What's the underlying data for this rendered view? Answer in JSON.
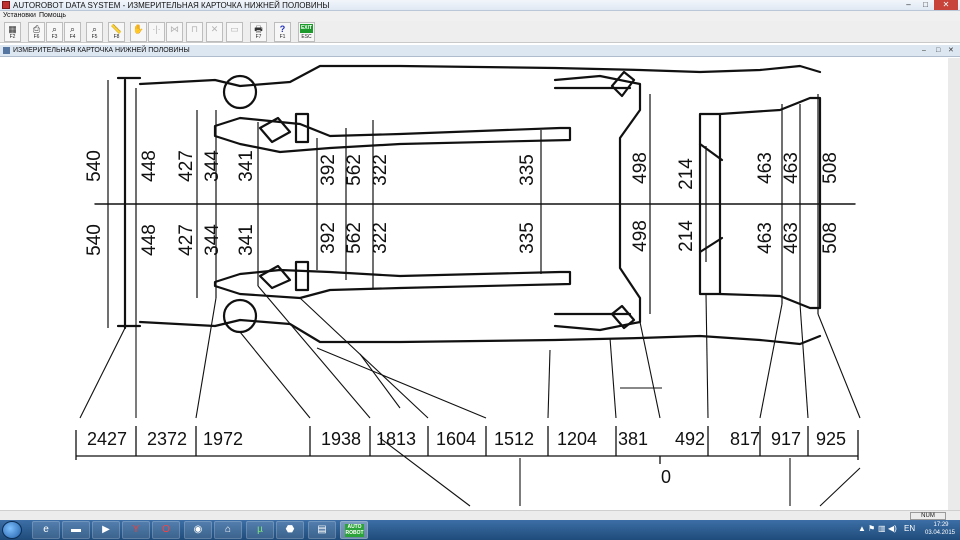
{
  "window": {
    "title": "AUTOROBOT DATA SYSTEM - ИЗМЕРИТЕЛЬНАЯ КАРТОЧКА НИЖНЕЙ ПОЛОВИНЫ",
    "minimize_glyph": "–",
    "maximize_glyph": "□",
    "close_glyph": "✕"
  },
  "menu": {
    "items": [
      {
        "label": "Установки"
      },
      {
        "label": "Помощь"
      }
    ]
  },
  "toolbar": {
    "buttons": [
      {
        "icon": "calculator-icon",
        "glyph": "▦",
        "key": "F2",
        "enabled": true
      },
      {
        "icon": "print-preview-icon",
        "glyph": "⎙",
        "key": "F6",
        "enabled": true
      },
      {
        "icon": "zoom-page-icon",
        "glyph": "⌕",
        "key": "F3",
        "enabled": true
      },
      {
        "icon": "zoom-in-icon",
        "glyph": "⌕",
        "key": "F4",
        "enabled": true
      },
      {
        "icon": "zoom-pointer-icon",
        "glyph": "⌕",
        "key": "F5",
        "enabled": true
      },
      {
        "icon": "ruler-icon",
        "glyph": "📏",
        "key": "F8",
        "enabled": true
      },
      {
        "icon": "hand-icon",
        "glyph": "✋",
        "key": "",
        "enabled": false
      },
      {
        "icon": "measure-point-icon",
        "glyph": "·|·",
        "key": "",
        "enabled": false
      },
      {
        "icon": "mirror-icon",
        "glyph": "⋈",
        "key": "",
        "enabled": false
      },
      {
        "icon": "bracket-icon",
        "glyph": "⊓",
        "key": "",
        "enabled": false
      },
      {
        "icon": "cross-icon",
        "glyph": "✕",
        "key": "",
        "enabled": false
      },
      {
        "icon": "panel-icon",
        "glyph": "▭",
        "key": "",
        "enabled": false
      },
      {
        "icon": "printer-icon",
        "glyph": "🖶",
        "key": "F7",
        "enabled": true
      },
      {
        "icon": "help-icon",
        "glyph": "?",
        "key": "F1",
        "enabled": true
      },
      {
        "icon": "exit-icon",
        "glyph": "EXIT",
        "key": "ESC",
        "enabled": true
      }
    ]
  },
  "inner_window": {
    "title": "ИЗМЕРИТЕЛЬНАЯ КАРТОЧКА НИЖНЕЙ ПОЛОВИНЫ",
    "minimize_glyph": "–",
    "maximize_glyph": "□",
    "close_glyph": "✕"
  },
  "drawing": {
    "stroke_color": "#111111",
    "vertical_dims_left": [
      "540",
      "448",
      "427",
      "344",
      "341",
      "392",
      "562",
      "322",
      "335"
    ],
    "vertical_dims_right": [
      "498",
      "214",
      "463",
      "463",
      "508"
    ],
    "bottom_dims": [
      "2427",
      "2372",
      "1972",
      "1938",
      "1813",
      "1604",
      "1512",
      "1204",
      "381",
      "492",
      "817",
      "917",
      "925"
    ],
    "zero_label": "0"
  },
  "statusbar": {
    "num_indicator": "NUM"
  },
  "taskbar": {
    "apps": [
      {
        "icon": "ie-icon",
        "glyph": "e"
      },
      {
        "icon": "explorer-folder-icon",
        "glyph": "▬"
      },
      {
        "icon": "media-player-icon",
        "glyph": "▶"
      },
      {
        "icon": "yandex-browser-icon",
        "glyph": "Y"
      },
      {
        "icon": "opera-icon",
        "glyph": "O"
      },
      {
        "icon": "chrome-like-icon",
        "glyph": "◉"
      },
      {
        "icon": "network-app-icon",
        "glyph": "⌂"
      },
      {
        "icon": "utorrent-icon",
        "glyph": "µ"
      },
      {
        "icon": "game-icon",
        "glyph": "⬣"
      },
      {
        "icon": "document-icon",
        "glyph": "▤"
      },
      {
        "icon": "autorobot-icon",
        "glyph": "AUTO ROBOT"
      }
    ],
    "tray": {
      "show_hidden_glyph": "▲",
      "flag_glyph": "⚑",
      "network_glyph": "▥",
      "volume_glyph": "◀)",
      "language": "EN",
      "time": "17:29",
      "date": "03.04.2015"
    }
  }
}
